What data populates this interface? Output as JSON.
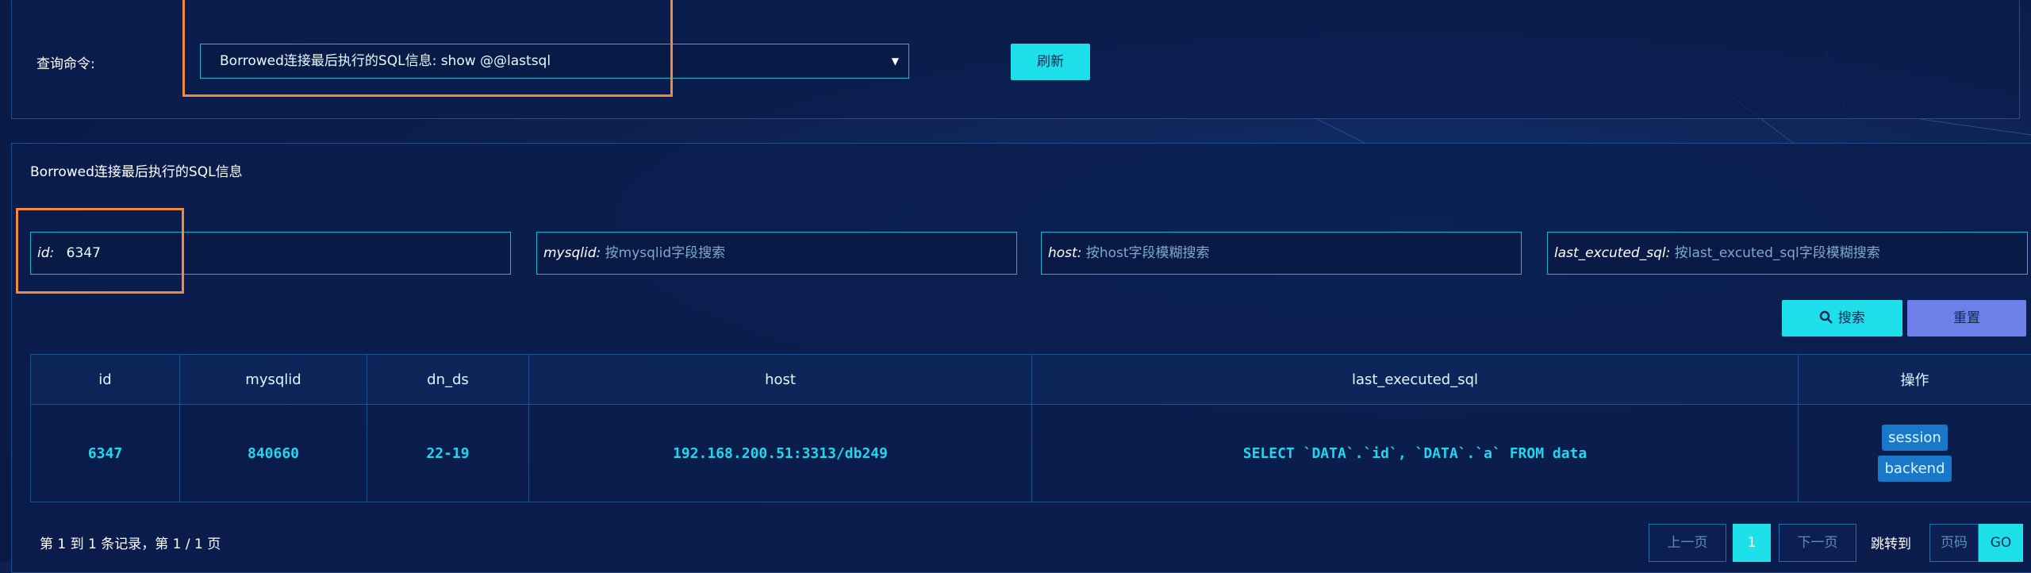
{
  "query": {
    "label": "查询命令:",
    "selected": "Borrowed连接最后执行的SQL信息: show @@lastsql",
    "refresh_label": "刷新"
  },
  "result": {
    "title": "Borrowed连接最后执行的SQL信息",
    "filters": [
      {
        "label": "id:",
        "value": "6347",
        "placeholder": ""
      },
      {
        "label": "mysqlid:",
        "value": "",
        "placeholder": "按mysqlid字段搜索"
      },
      {
        "label": "host:",
        "value": "",
        "placeholder": "按host字段模糊搜索"
      },
      {
        "label": "last_excuted_sql:",
        "value": "",
        "placeholder": "按last_excuted_sql字段模糊搜索"
      }
    ],
    "search_label": "搜索",
    "reset_label": "重置",
    "columns": [
      "id",
      "mysqlid",
      "dn_ds",
      "host",
      "last_executed_sql",
      "操作"
    ],
    "rows": [
      {
        "id": "6347",
        "mysqlid": "840660",
        "dn_ds": "22-19",
        "host": "192.168.200.51:3313/db249",
        "last_executed_sql": "SELECT `DATA`.`id`, `DATA`.`a` FROM data",
        "actions": [
          "session",
          "backend"
        ]
      }
    ]
  },
  "pagination": {
    "summary": "第 1 到 1 条记录，第 1 / 1 页",
    "prev_label": "上一页",
    "current_page": "1",
    "next_label": "下一页",
    "jump_label": "跳转到",
    "page_placeholder": "页码",
    "go_label": "GO"
  },
  "colors": {
    "accent": "#1ee0ea",
    "highlight": "#f08a3c",
    "reset": "#6d7fe8"
  }
}
